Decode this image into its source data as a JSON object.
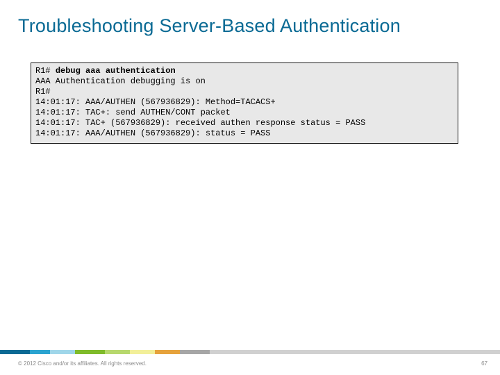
{
  "title": "Troubleshooting Server-Based Authentication",
  "code": {
    "prompt": "R1# ",
    "cmd": "debug aaa authentication",
    "lines": [
      "AAA Authentication debugging is on",
      "R1#",
      "14:01:17: AAA/AUTHEN (567936829): Method=TACACS+",
      "14:01:17: TAC+: send AUTHEN/CONT packet",
      "14:01:17: TAC+ (567936829): received authen response status = PASS",
      "14:01:17: AAA/AUTHEN (567936829): status = PASS"
    ]
  },
  "stripe": {
    "segments": [
      {
        "color": "#0a6a94",
        "w": "6%"
      },
      {
        "color": "#2aa3d0",
        "w": "4%"
      },
      {
        "color": "#9fd6e9",
        "w": "5%"
      },
      {
        "color": "#7fbb2a",
        "w": "6%"
      },
      {
        "color": "#b7d86d",
        "w": "5%"
      },
      {
        "color": "#f2ef99",
        "w": "5%"
      },
      {
        "color": "#e6a23c",
        "w": "5%"
      },
      {
        "color": "#a6a6a6",
        "w": "6%"
      },
      {
        "color": "#d0d0d0",
        "w": "58%"
      }
    ]
  },
  "copyright": "© 2012 Cisco and/or its affiliates. All rights reserved.",
  "pagenum": "67"
}
